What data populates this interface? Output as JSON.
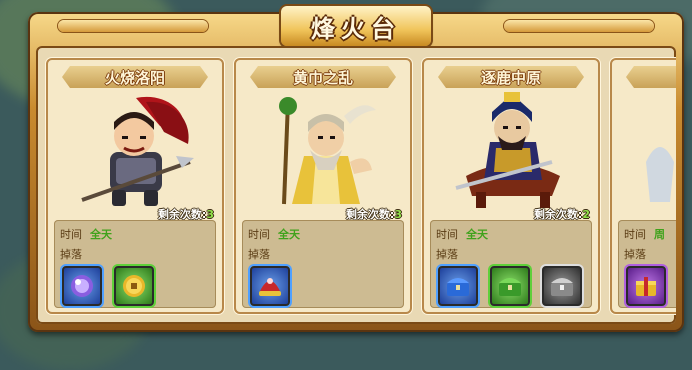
{
  "title": "烽火台",
  "cards": [
    {
      "name": "火烧洛阳",
      "remaining_label": "剩余次数:",
      "remaining_count": "3",
      "time_label": "时间",
      "time_value": "全天",
      "drop_label": "掉落",
      "drops": [
        {
          "icon": "purple-orb-icon",
          "quality": "blue"
        },
        {
          "icon": "gold-coin-icon",
          "quality": "green"
        }
      ]
    },
    {
      "name": "黄巾之乱",
      "remaining_label": "剩余次数:",
      "remaining_count": "3",
      "time_label": "时间",
      "time_value": "全天",
      "drop_label": "掉落",
      "drops": [
        {
          "icon": "red-helmet-icon",
          "quality": "blue"
        }
      ]
    },
    {
      "name": "逐鹿中原",
      "remaining_label": "剩余次数:",
      "remaining_count": "2",
      "time_label": "时间",
      "time_value": "全天",
      "drop_label": "掉落",
      "drops": [
        {
          "icon": "blue-chest-icon",
          "quality": "blue"
        },
        {
          "icon": "green-chest-icon",
          "quality": "green"
        },
        {
          "icon": "silver-chest-icon",
          "quality": "white"
        }
      ]
    },
    {
      "name": "",
      "time_label": "时间",
      "time_value": "周",
      "drop_label": "掉落",
      "drops": [
        {
          "icon": "gold-box-icon",
          "quality": "purple"
        }
      ]
    }
  ]
}
